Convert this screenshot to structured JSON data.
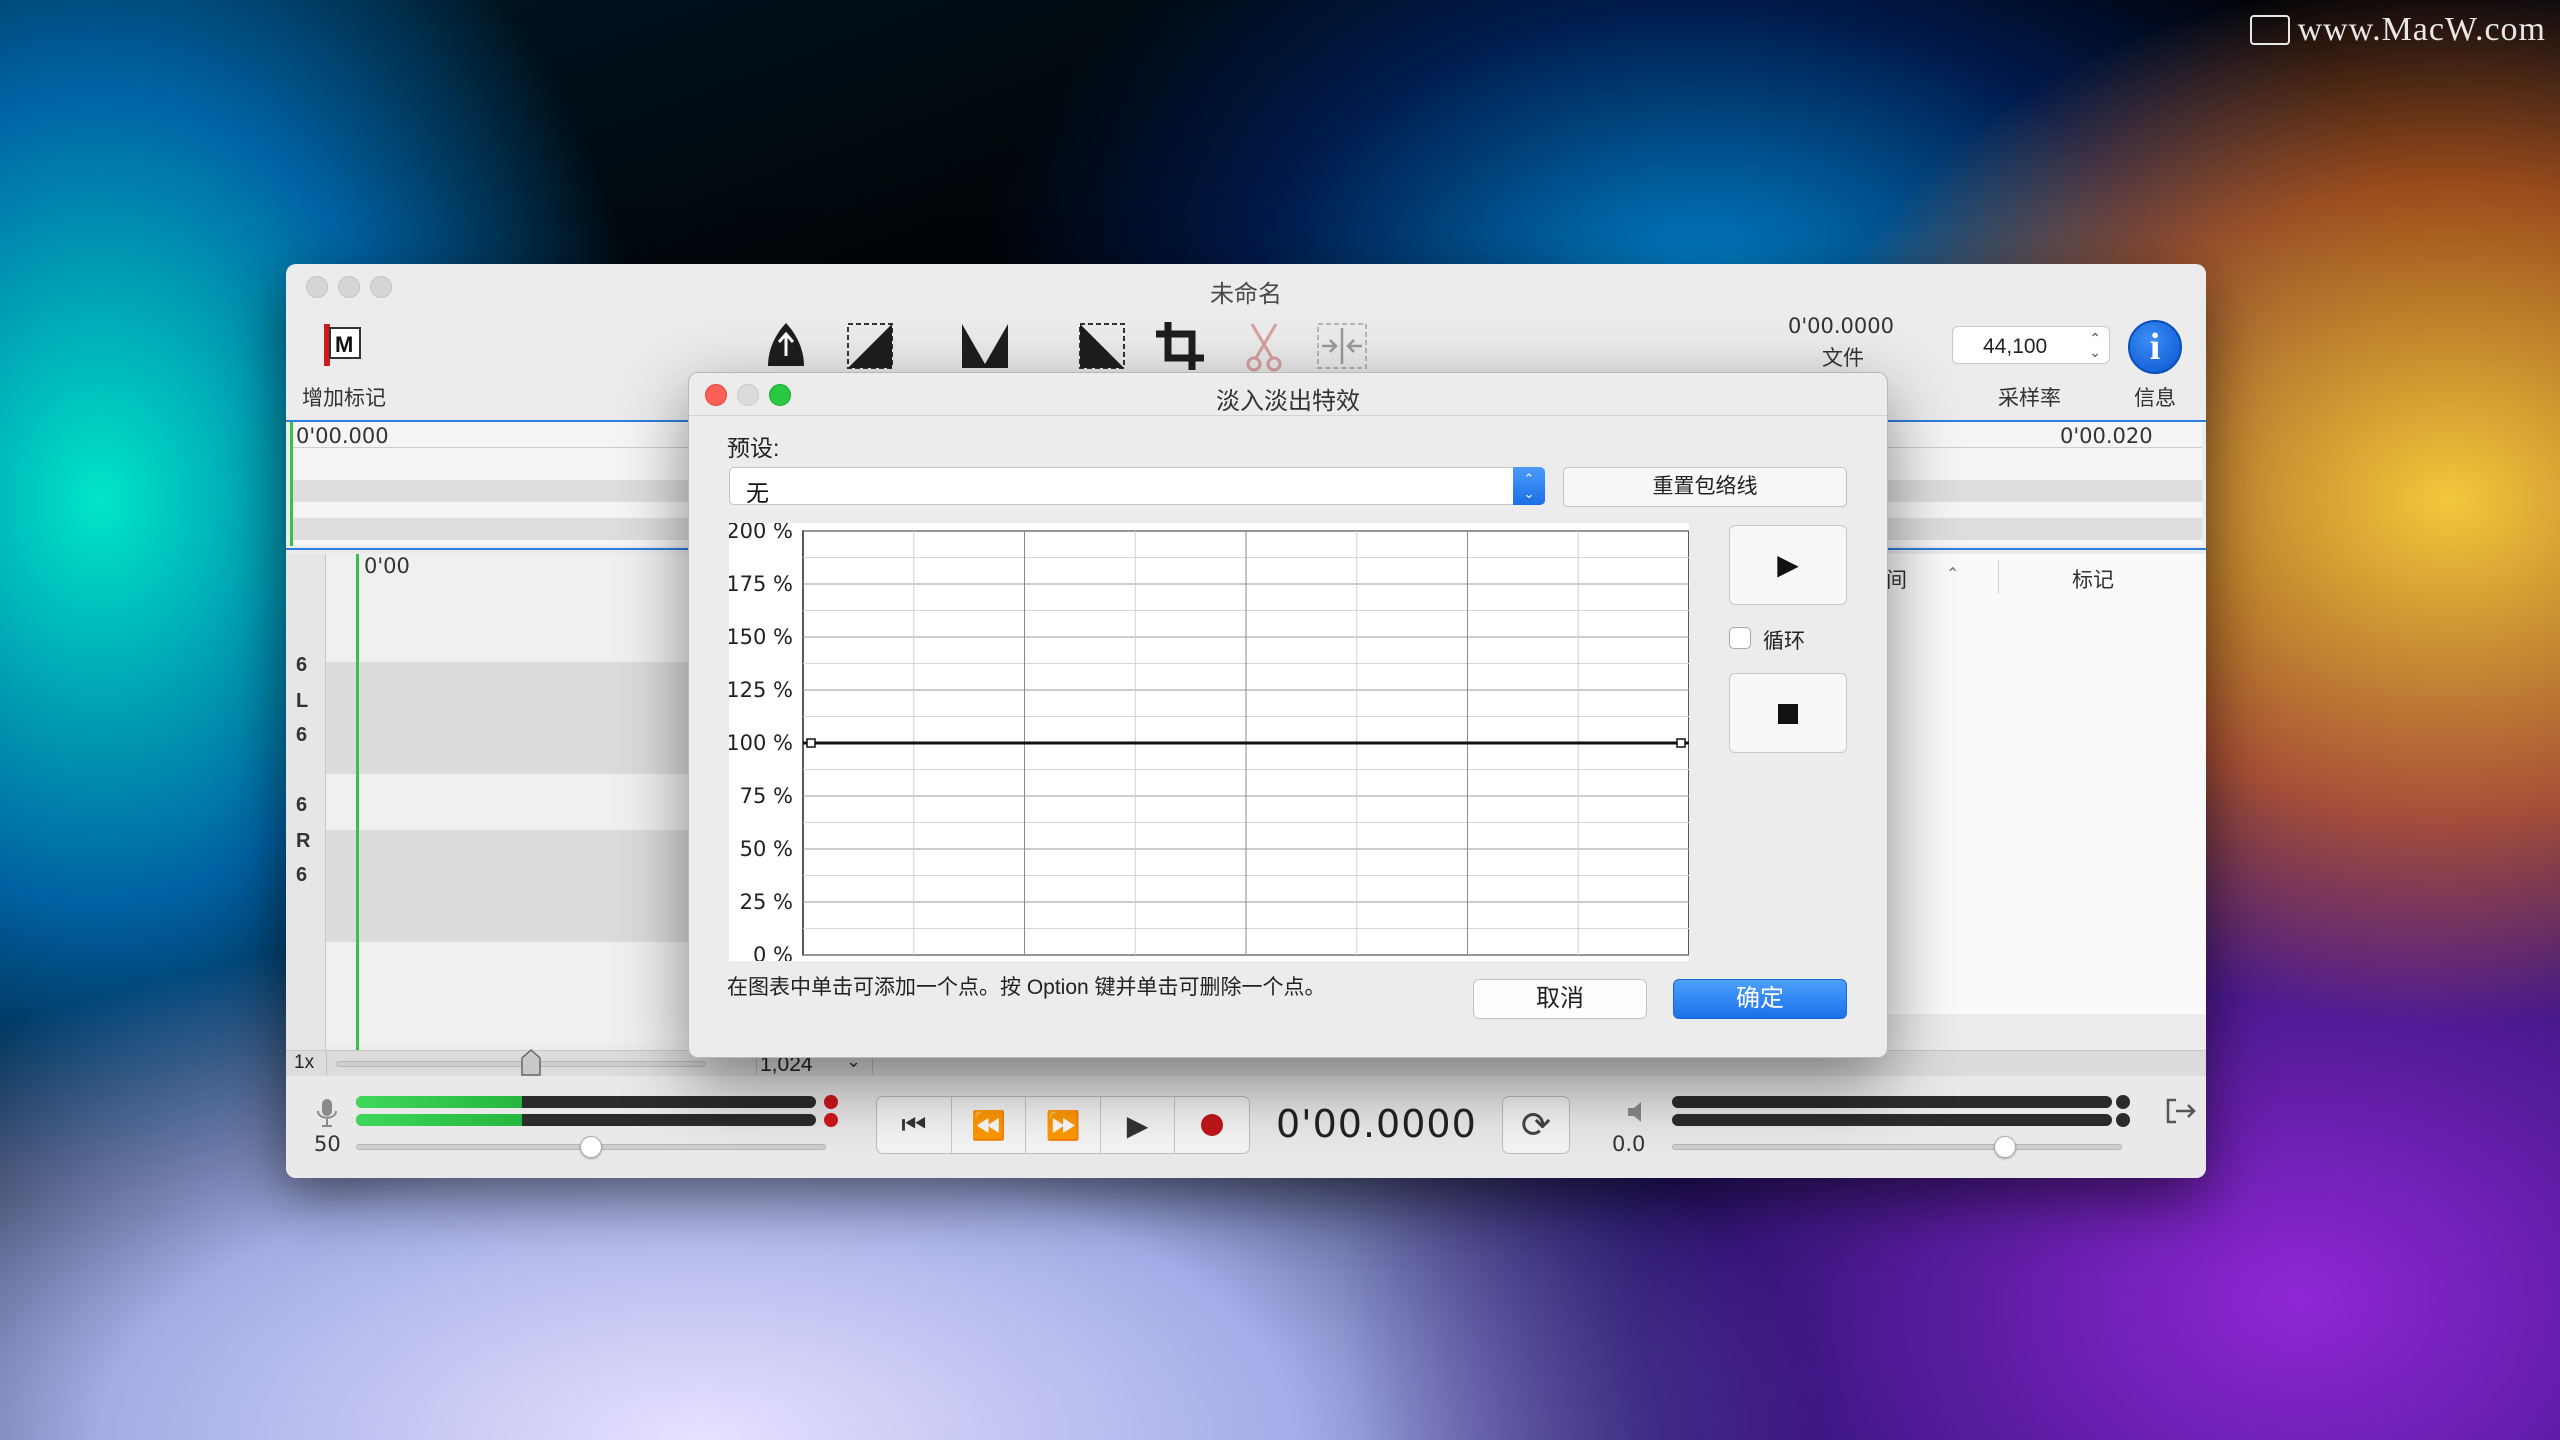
{
  "watermark": "www.MacW.com",
  "window": {
    "title": "未命名",
    "add_marker_label": "增加标记",
    "file_time": "0'00.0000",
    "file_label": "文件",
    "sample_rate_value": "44,100",
    "sample_rate_label": "采样率",
    "info_label": "信息",
    "info_icon_glyph": "i",
    "ruler_start": "0'00.000",
    "ruler_end": "0'00.020",
    "track_ruler_start": "0'00",
    "channel_labels": [
      "6",
      "L",
      "6",
      "6",
      "R",
      "6"
    ],
    "zoom_label": "1x",
    "buffer_value": "1,024",
    "markers_header_partial": "间",
    "markers_header": "标记",
    "input_level": "50",
    "output_level": "0.0",
    "transport_time": "0'00.0000",
    "input_meter_fill": [
      0.36,
      0.36
    ],
    "input_slider": 0.5,
    "output_slider": 0.74
  },
  "dialog": {
    "title": "淡入淡出特效",
    "preset_label": "预设:",
    "preset_value": "无",
    "reset_button": "重置包络线",
    "loop_label": "循环",
    "loop_checked": false,
    "hint": "在图表中单击可添加一个点。按 Option 键并单击可删除一个点。",
    "cancel": "取消",
    "ok": "确定"
  },
  "chart_data": {
    "type": "line",
    "ylim": [
      0,
      200
    ],
    "yticks": [
      "200 %",
      "175 %",
      "150 %",
      "125 %",
      "100 %",
      "75 %",
      "50 %",
      "25 %",
      "0 %"
    ],
    "xlim": [
      0,
      1
    ],
    "series": [
      {
        "x": [
          0,
          1
        ],
        "values": [
          100,
          100
        ]
      }
    ],
    "grid": true
  },
  "colors": {
    "accent_blue": "#1b70ea",
    "record_red": "#c0161b",
    "meter_green": "#3fd85a",
    "playhead_green": "#35c24a"
  }
}
